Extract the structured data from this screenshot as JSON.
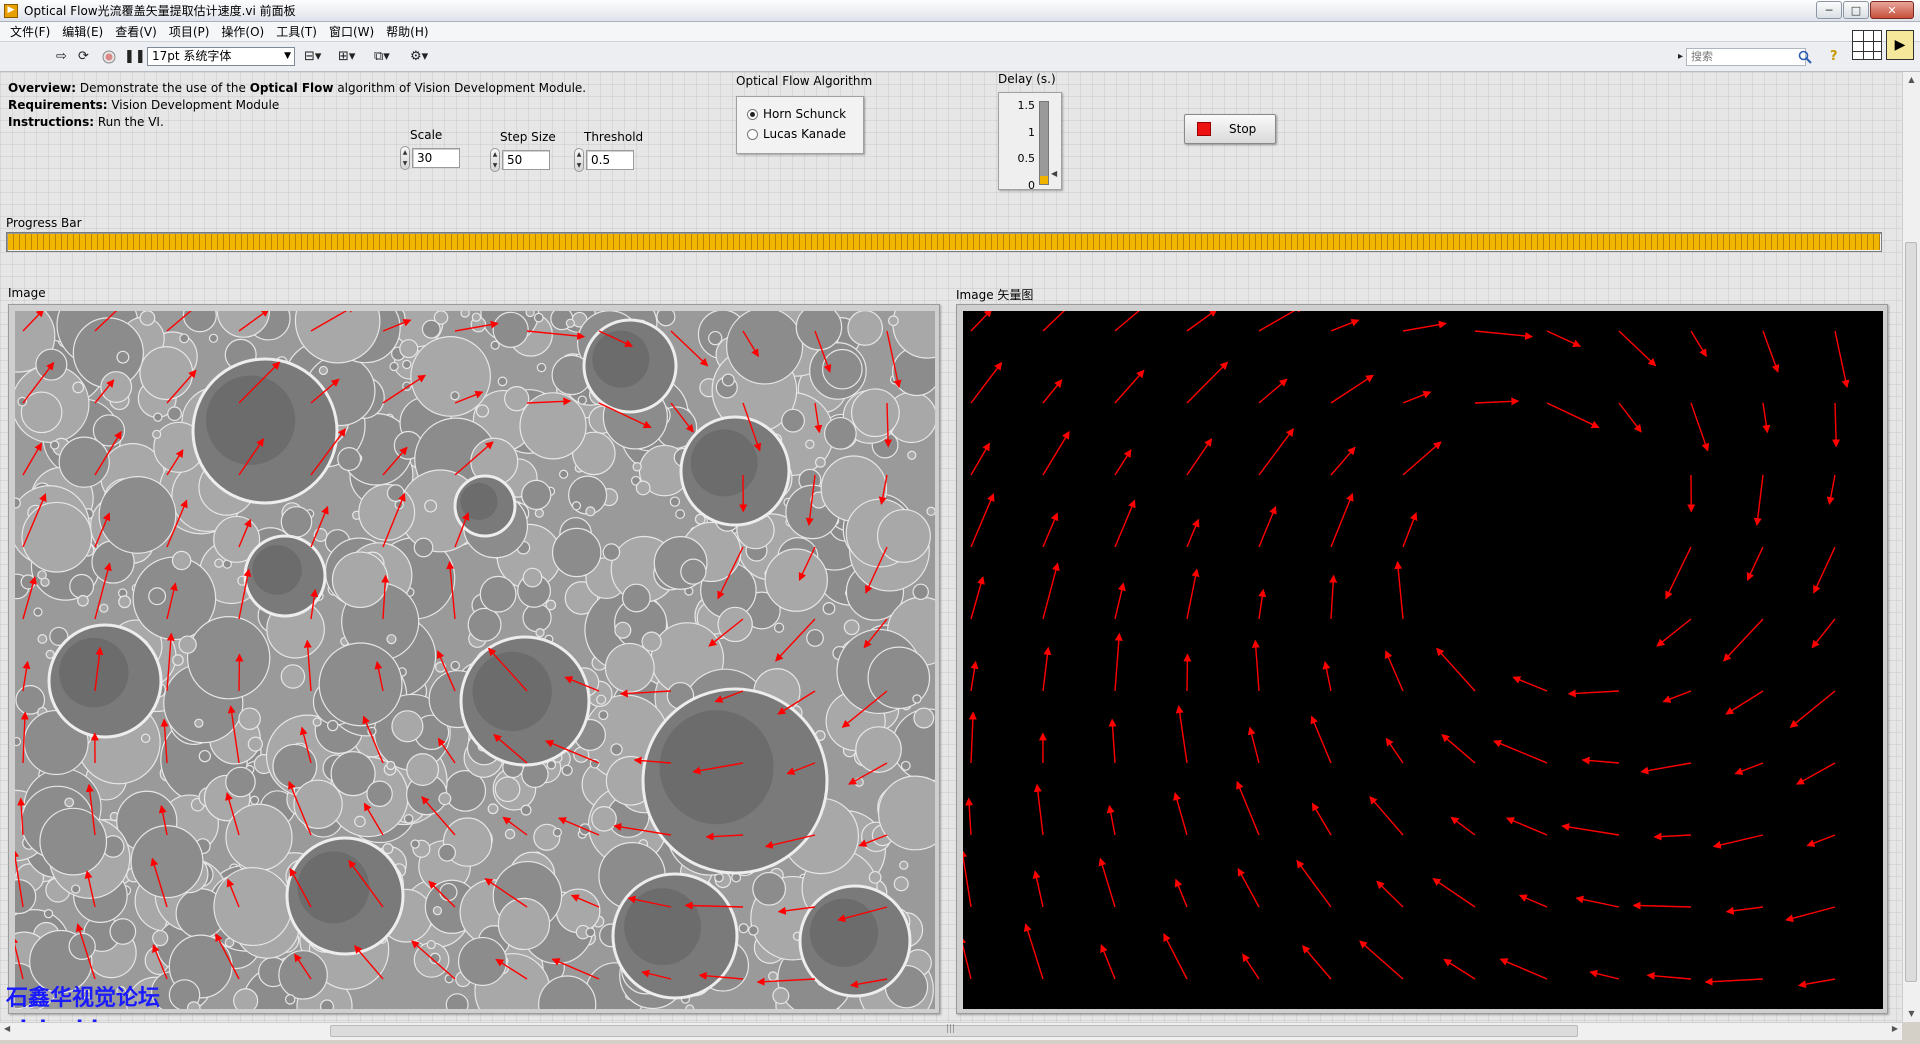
{
  "window": {
    "title": "Optical Flow光流覆盖矢量提取估计速度.vi 前面板",
    "controls": {
      "minimize": "─",
      "maximize": "□",
      "close": "✕"
    }
  },
  "menu": {
    "items": [
      "文件(F)",
      "编辑(E)",
      "查看(V)",
      "项目(P)",
      "操作(O)",
      "工具(T)",
      "窗口(W)",
      "帮助(H)"
    ]
  },
  "toolbar": {
    "font_select": "17pt 系统字体",
    "search_placeholder": "搜索"
  },
  "description": {
    "overview_label": "Overview:",
    "overview_text_1": " Demonstrate the use of the ",
    "overview_bold": "Optical Flow",
    "overview_text_2": " algorithm of Vision Development Module.",
    "requirements_label": "Requirements:",
    "requirements_text": " Vision Development Module",
    "instructions_label": "Instructions:",
    "instructions_text": " Run the VI."
  },
  "controls": {
    "scale": {
      "label": "Scale",
      "value": "30"
    },
    "step_size": {
      "label": "Step Size",
      "value": "50"
    },
    "threshold": {
      "label": "Threshold",
      "value": "0.5"
    }
  },
  "algorithm": {
    "label": "Optical Flow Algorithm",
    "options": [
      "Horn Schunck",
      "Lucas Kanade"
    ],
    "selected": "Horn Schunck"
  },
  "delay": {
    "label": "Delay (s.)",
    "ticks": [
      "1.5",
      "1",
      "0.5",
      "0"
    ],
    "value": 0.15,
    "max": 1.5
  },
  "stop_button": {
    "label": "Stop"
  },
  "progress": {
    "label": "Progress Bar",
    "value": 100
  },
  "image_left": {
    "label": "Image"
  },
  "image_right": {
    "label": "Image 矢量图"
  },
  "watermark": {
    "line1": "石鑫华视觉论坛",
    "line2": "visionbbs.com"
  },
  "colors": {
    "vector": "#ff0000",
    "progress": "#f2b600",
    "stop": "#ee1111"
  }
}
